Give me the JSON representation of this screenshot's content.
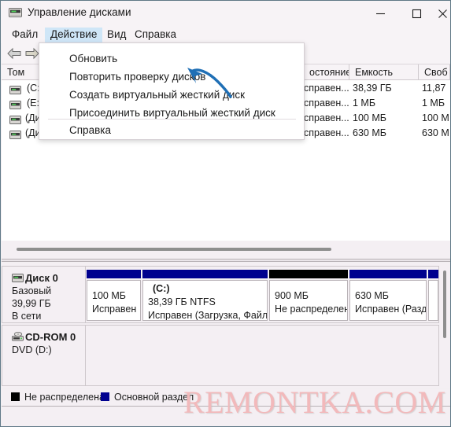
{
  "window": {
    "title": "Управление дисками",
    "icon": "disk-drive-icon",
    "controls": {
      "minimize": "—",
      "maximize": "▢",
      "close": "✕"
    }
  },
  "menubar": {
    "items": [
      {
        "label": "Файл",
        "active": false
      },
      {
        "label": "Действие",
        "active": true
      },
      {
        "label": "Вид",
        "active": false
      },
      {
        "label": "Справка",
        "active": false
      }
    ]
  },
  "toolbar": {
    "back_icon": "back-arrow-icon",
    "forward_icon": "forward-arrow-icon"
  },
  "dropdown": {
    "owner": "Действие",
    "items": [
      {
        "label": "Обновить"
      },
      {
        "label": "Повторить проверку дисков"
      },
      {
        "label": "Создать виртуальный жесткий диск"
      },
      {
        "label": "Присоединить виртуальный жесткий диск"
      },
      {
        "label": "Справка"
      }
    ]
  },
  "volume_list": {
    "columns": [
      {
        "label": "Том"
      },
      {
        "label": ""
      },
      {
        "label": "остояние"
      },
      {
        "label": "Емкость"
      },
      {
        "label": "Своб"
      }
    ],
    "rows": [
      {
        "volume": "(C:)",
        "state": "справен...",
        "capacity": "38,39 ГБ",
        "free": "11,87"
      },
      {
        "volume": "(E:)",
        "state": "справен...",
        "capacity": "1 МБ",
        "free": "1 МБ"
      },
      {
        "volume": "(Дис",
        "state": "справен...",
        "capacity": "100 МБ",
        "free": "100 М"
      },
      {
        "volume": "(Дис",
        "state": "справен...",
        "capacity": "630 МБ",
        "free": "630 М"
      }
    ]
  },
  "graphical_view": {
    "disks": [
      {
        "name": "Диск 0",
        "type": "Базовый",
        "size": "39,99 ГБ",
        "status": "В сети",
        "icon": "disk-drive-icon",
        "partitions": [
          {
            "label": "",
            "size": "100 МБ",
            "status": "Исправен",
            "color": "#00008f"
          },
          {
            "label": "(C:)",
            "size": "38,39 ГБ NTFS",
            "status": "Исправен (Загрузка, Файл",
            "color": "#00008f"
          },
          {
            "label": "",
            "size": "900 МБ",
            "status": "Не распределен",
            "color": "#000000"
          },
          {
            "label": "",
            "size": "630 МБ",
            "status": "Исправен (Разд",
            "color": "#00008f"
          },
          {
            "label": "",
            "size": "",
            "status": "",
            "color": "#00008f"
          }
        ]
      },
      {
        "name": "CD-ROM 0",
        "type": "DVD (D:)",
        "size": "",
        "status": "",
        "icon": "cdrom-icon",
        "partitions": []
      }
    ]
  },
  "legend": {
    "items": [
      {
        "label": "Не распределена",
        "color": "#000000"
      },
      {
        "label": "Основной раздел",
        "color": "#00008f"
      }
    ]
  },
  "watermark": {
    "text": "REMONTKA.COM",
    "color": "#f2b9bb"
  }
}
